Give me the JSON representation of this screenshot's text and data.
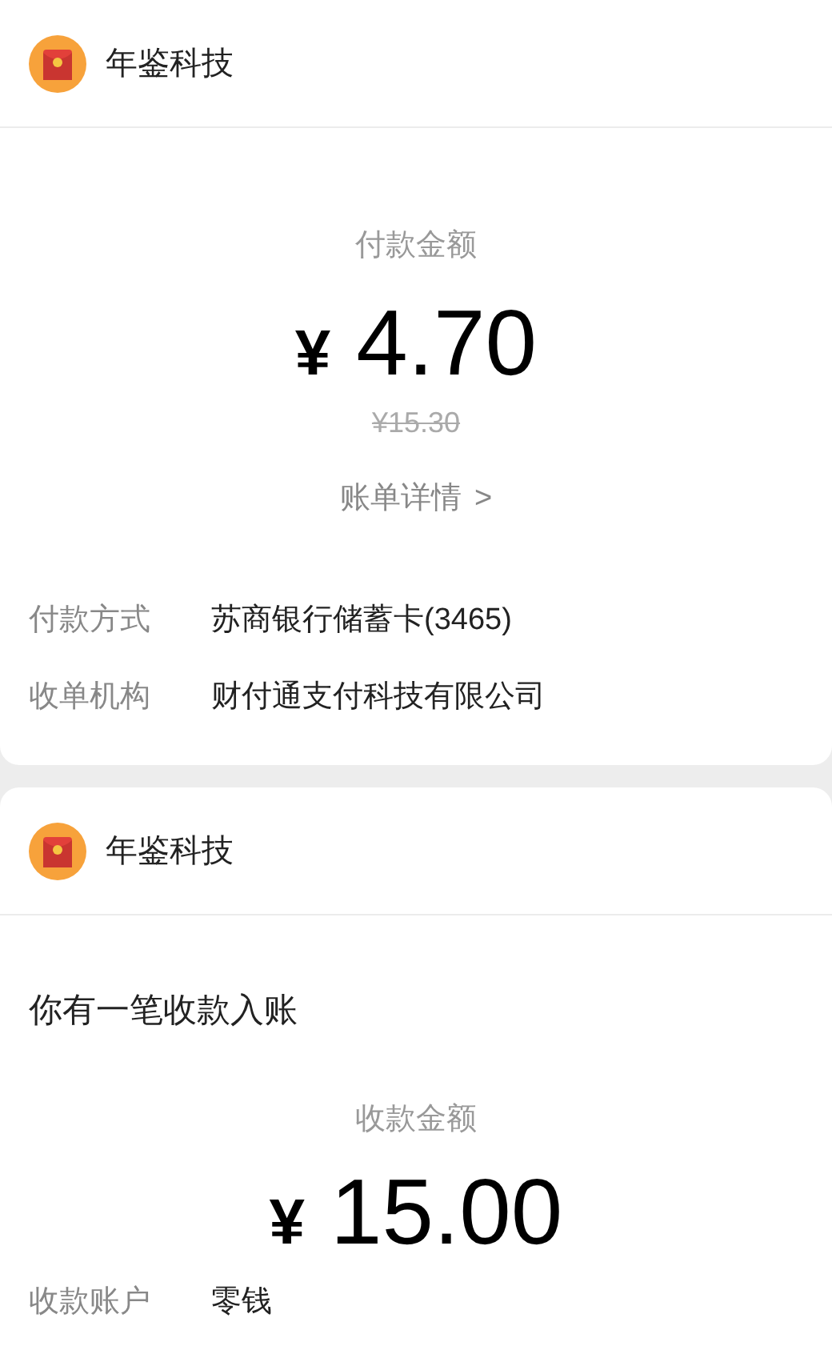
{
  "payment_card": {
    "merchant": "年鉴科技",
    "amount_label": "付款金额",
    "currency": "¥",
    "amount": "4.70",
    "original_amount": "¥15.30",
    "details_link": "账单详情",
    "details_chevron": ">",
    "rows": [
      {
        "label": "付款方式",
        "value": "苏商银行储蓄卡(3465)"
      },
      {
        "label": "收单机构",
        "value": "财付通支付科技有限公司"
      }
    ]
  },
  "receipt_card": {
    "merchant": "年鉴科技",
    "message": "你有一笔收款入账",
    "amount_label": "收款金额",
    "currency": "¥",
    "amount": "15.00",
    "rows": [
      {
        "label": "收款账户",
        "value": "零钱"
      }
    ]
  }
}
